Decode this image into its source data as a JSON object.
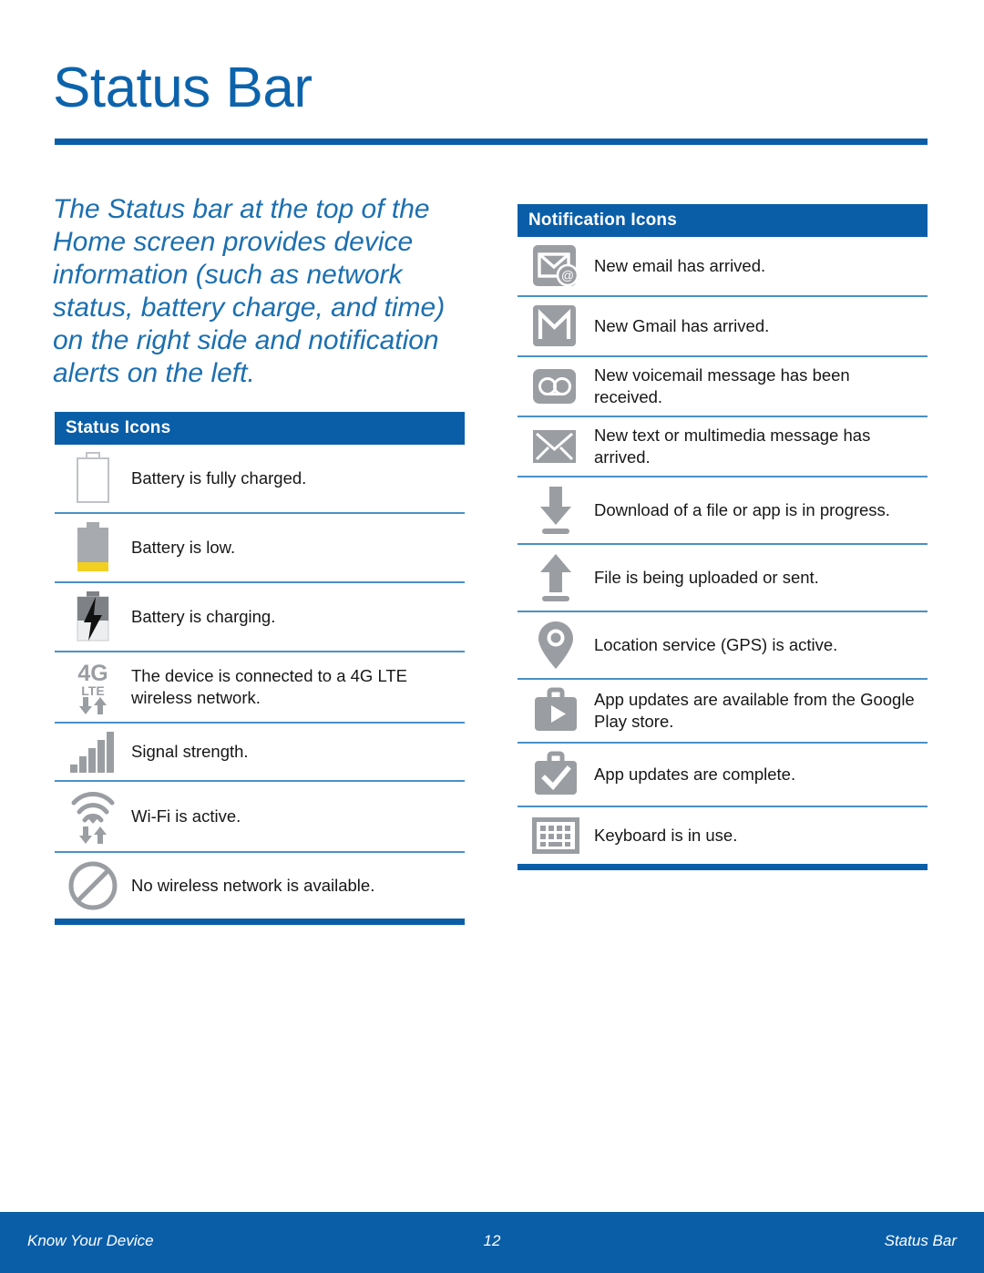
{
  "page": {
    "title": "Status Bar",
    "intro": "The Status bar at the top of the Home screen provides device information (such as network status, battery charge, and time) on the right side and notification alerts on the left."
  },
  "colors": {
    "brand_blue": "#0A5EA8",
    "title_blue": "#0C63AC",
    "intro_blue": "#1C6FB0",
    "divider_blue": "#4A90C8",
    "icon_gray": "#9A9DA2",
    "battery_yellow": "#F2D022"
  },
  "status_table": {
    "header": "Status Icons",
    "rows": [
      {
        "icon": "battery-full-icon",
        "text": "Battery is fully charged."
      },
      {
        "icon": "battery-low-icon",
        "text": "Battery is low."
      },
      {
        "icon": "battery-charging-icon",
        "text": "Battery is charging."
      },
      {
        "icon": "4g-lte-icon",
        "text": "The device is connected to a 4G LTE wireless network.",
        "glyph_primary": "4G",
        "glyph_secondary": "LTE"
      },
      {
        "icon": "signal-strength-icon",
        "text": "Signal strength."
      },
      {
        "icon": "wifi-active-icon",
        "text": "Wi-Fi is active."
      },
      {
        "icon": "no-network-icon",
        "text": "No wireless network is available."
      }
    ]
  },
  "notification_table": {
    "header": "Notification Icons",
    "rows": [
      {
        "icon": "new-email-icon",
        "text": "New email has arrived."
      },
      {
        "icon": "new-gmail-icon",
        "text": "New Gmail has arrived."
      },
      {
        "icon": "new-voicemail-icon",
        "text": "New voicemail message has been received."
      },
      {
        "icon": "new-message-icon",
        "text": "New text or multimedia message has arrived."
      },
      {
        "icon": "download-icon",
        "text": "Download of a file or app is in progress."
      },
      {
        "icon": "upload-icon",
        "text": "File is being uploaded or sent."
      },
      {
        "icon": "location-gps-icon",
        "text": "Location service (GPS) is active."
      },
      {
        "icon": "play-store-update-icon",
        "text": "App updates are available from the Google Play store."
      },
      {
        "icon": "update-complete-icon",
        "text": "App updates are complete."
      },
      {
        "icon": "keyboard-icon",
        "text": "Keyboard is in use."
      }
    ]
  },
  "footer": {
    "left": "Know Your Device",
    "page_number": "12",
    "right": "Status Bar"
  }
}
